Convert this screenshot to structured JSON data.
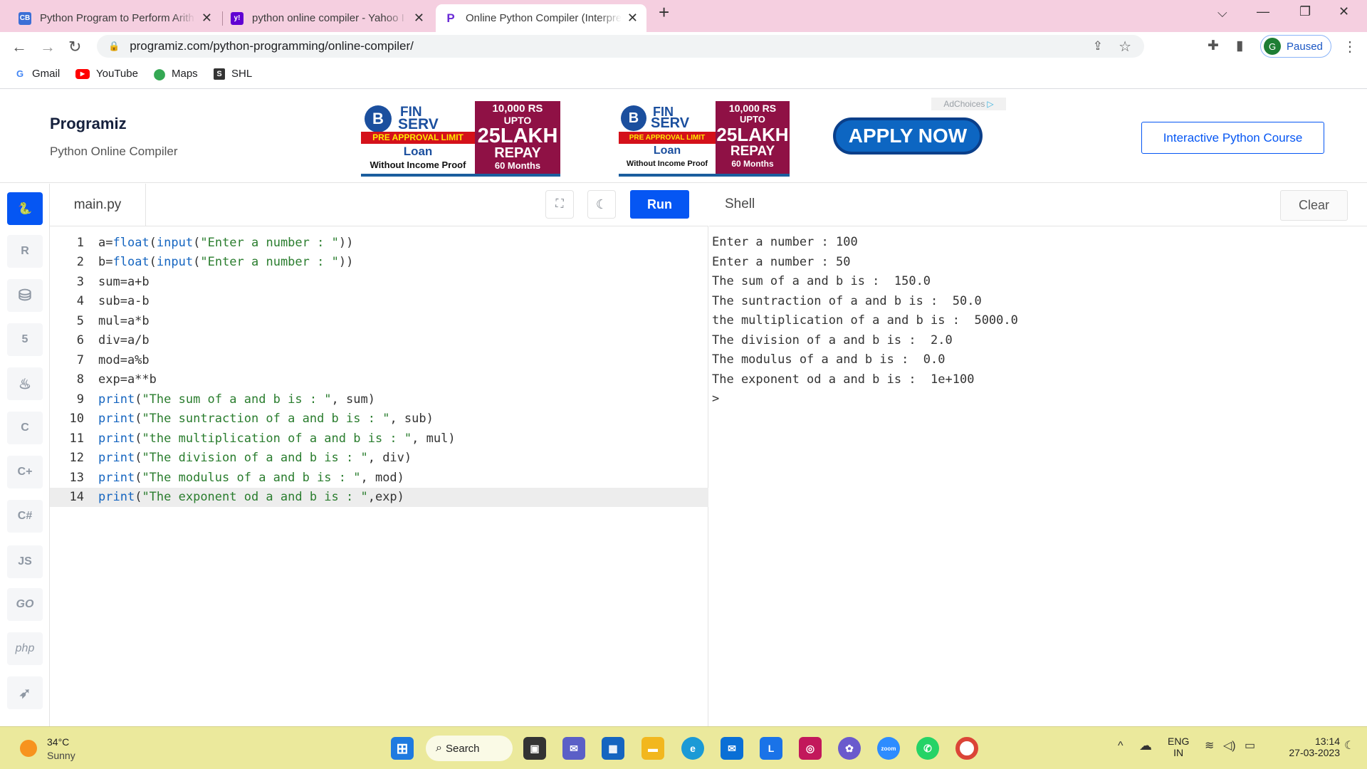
{
  "browser": {
    "tabs": [
      {
        "title": "Python Program to Perform Arith",
        "favicon": "CB"
      },
      {
        "title": "python online compiler - Yahoo I",
        "favicon": "y!"
      },
      {
        "title": "Online Python Compiler (Interpre",
        "favicon": "P"
      }
    ],
    "new_tab": "+",
    "url": "programiz.com/python-programming/online-compiler/",
    "profile_initial": "G",
    "profile_status": "Paused",
    "bookmarks": [
      "Gmail",
      "YouTube",
      "Maps",
      "SHL"
    ]
  },
  "site": {
    "logo": "Programiz",
    "subtitle": "Python Online Compiler",
    "course_button": "Interactive Python Course",
    "ad_choices": "AdChoices",
    "ads": [
      {
        "brand1": "FIN",
        "brand2": "SERV",
        "limit": "PRE APPROVAL LIMIT",
        "loan": "Loan",
        "proof": "Without Income Proof",
        "amount": "10,000 RS",
        "upto": "UPTO",
        "lakh": "25LAKH",
        "repay": "REPAY",
        "months": "60 Months"
      },
      {
        "brand1": "FIN",
        "brand2": "SERV",
        "limit": "PRE APPROVAL LIMIT",
        "loan": "Loan",
        "proof": "Without Income Proof",
        "amount": "10,000 RS",
        "upto": "UPTO",
        "lakh": "25LAKH",
        "repay": "REPAY",
        "months": "60 Months"
      }
    ],
    "apply_button": "APPLY NOW"
  },
  "sidebar": {
    "items": [
      "python",
      "r",
      "sql",
      "html",
      "java",
      "c",
      "cpp",
      "csharp",
      "JS",
      "GO",
      "php",
      "swift"
    ]
  },
  "editor": {
    "filename": "main.py",
    "run_label": "Run",
    "lines": [
      "a=float(input(\"Enter a number : \"))",
      "b=float(input(\"Enter a number : \"))",
      "sum=a+b",
      "sub=a-b",
      "mul=a*b",
      "div=a/b",
      "mod=a%b",
      "exp=a**b",
      "print(\"The sum of a and b is : \", sum)",
      "print(\"The suntraction of a and b is : \", sub)",
      "print(\"the multiplication of a and b is : \", mul)",
      "print(\"The division of a and b is : \", div)",
      "print(\"The modulus of a and b is : \", mod)",
      "print(\"The exponent od a and b is : \",exp)"
    ],
    "current_line": 14
  },
  "shell": {
    "title": "Shell",
    "clear_label": "Clear",
    "output": [
      "Enter a number : 100",
      "Enter a number : 50",
      "The sum of a and b is :  150.0",
      "The suntraction of a and b is :  50.0",
      "the multiplication of a and b is :  5000.0",
      "The division of a and b is :  2.0",
      "The modulus of a and b is :  0.0",
      "The exponent od a and b is :  1e+100",
      ">"
    ]
  },
  "taskbar": {
    "weather_temp": "34°C",
    "weather_desc": "Sunny",
    "search_label": "Search",
    "lang_top": "ENG",
    "lang_bottom": "IN",
    "time": "13:14",
    "date": "27-03-2023"
  },
  "colors": {
    "accent": "#0556f3",
    "tabbar": "#f5cfe0",
    "taskbar": "#ebe99c"
  }
}
